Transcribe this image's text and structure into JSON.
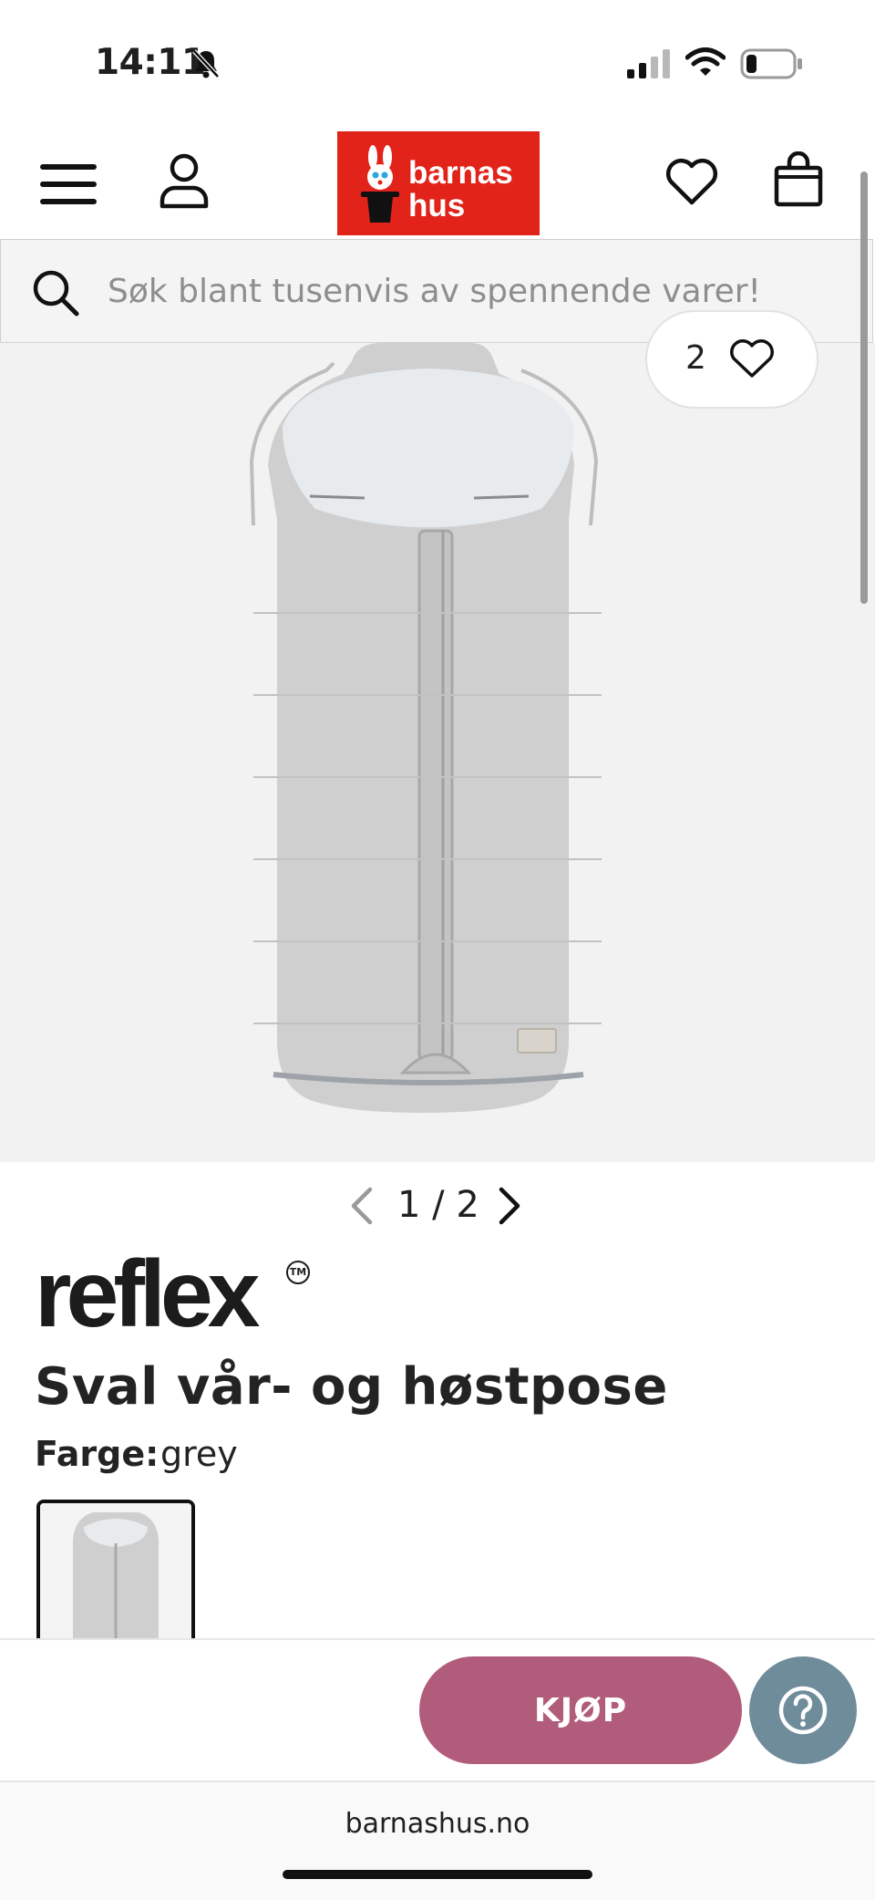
{
  "status_bar": {
    "time": "14:11"
  },
  "header": {
    "logo_text": "barnas hus",
    "logo_color": "#e2231a"
  },
  "search": {
    "placeholder": "Søk blant tusenvis av spennende varer!"
  },
  "gallery": {
    "like_count": "2",
    "pager": "1 / 2"
  },
  "product": {
    "brand": "reflex",
    "brand_mark": "TM",
    "title": "Sval vår- og høstpose",
    "color_label": "Farge:",
    "color_value": "grey"
  },
  "actions": {
    "buy_label": "KJØP",
    "buy_color": "#b05c7a",
    "help_color": "#6f8c9b"
  },
  "browser": {
    "url": "barnashus.no"
  },
  "icons": [
    "bell-slash-icon",
    "signal-icon",
    "wifi-icon",
    "battery-icon",
    "menu-icon",
    "account-icon",
    "wishlist-icon",
    "cart-icon",
    "search-icon",
    "heart-icon",
    "chevron-left-icon",
    "chevron-right-icon",
    "help-icon"
  ]
}
